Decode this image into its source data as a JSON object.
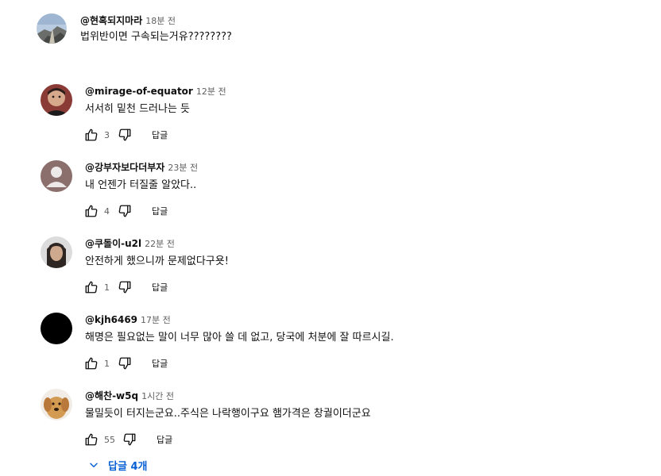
{
  "comments": [
    {
      "author": "@현혹되지마라",
      "time": "18분 전",
      "text": "법위반이면 구속되는거유????????"
    }
  ],
  "replies": [
    {
      "author": "@mirage-of-equator",
      "time": "12분 전",
      "text": "서서히 밑천 드러나는 듯",
      "likes": "3",
      "reply_label": "답글"
    },
    {
      "author": "@강부자보다더부자",
      "time": "23분 전",
      "text": "내 언젠가 터질줄 알았다..",
      "likes": "4",
      "reply_label": "답글"
    },
    {
      "author": "@쿠돌이-u2l",
      "time": "22분 전",
      "text": "안전하게 했으니까 문제없다구욧!",
      "likes": "1",
      "reply_label": "답글"
    },
    {
      "author": "@kjh6469",
      "time": "17분 전",
      "text": "해명은 필요없는 말이 너무 많아 쓸 데 없고, 당국에 처분에 잘 따르시길.",
      "likes": "1",
      "reply_label": "답글"
    },
    {
      "author": "@해찬-w5q",
      "time": "1시간 전",
      "text": "물밀듯이 터지는군요..주식은 나락행이구요 햄가격은 창궐이더군요",
      "likes": "55",
      "reply_label": "답글"
    }
  ],
  "more_replies": {
    "label": "답글 4개",
    "icon": "chevron-down-icon"
  },
  "icons": {
    "like": "thumbs-up-icon",
    "dislike": "thumbs-down-icon"
  },
  "colors": {
    "link_blue": "#065fd4",
    "secondary_text": "#606060",
    "primary_text": "#0f0f0f"
  }
}
